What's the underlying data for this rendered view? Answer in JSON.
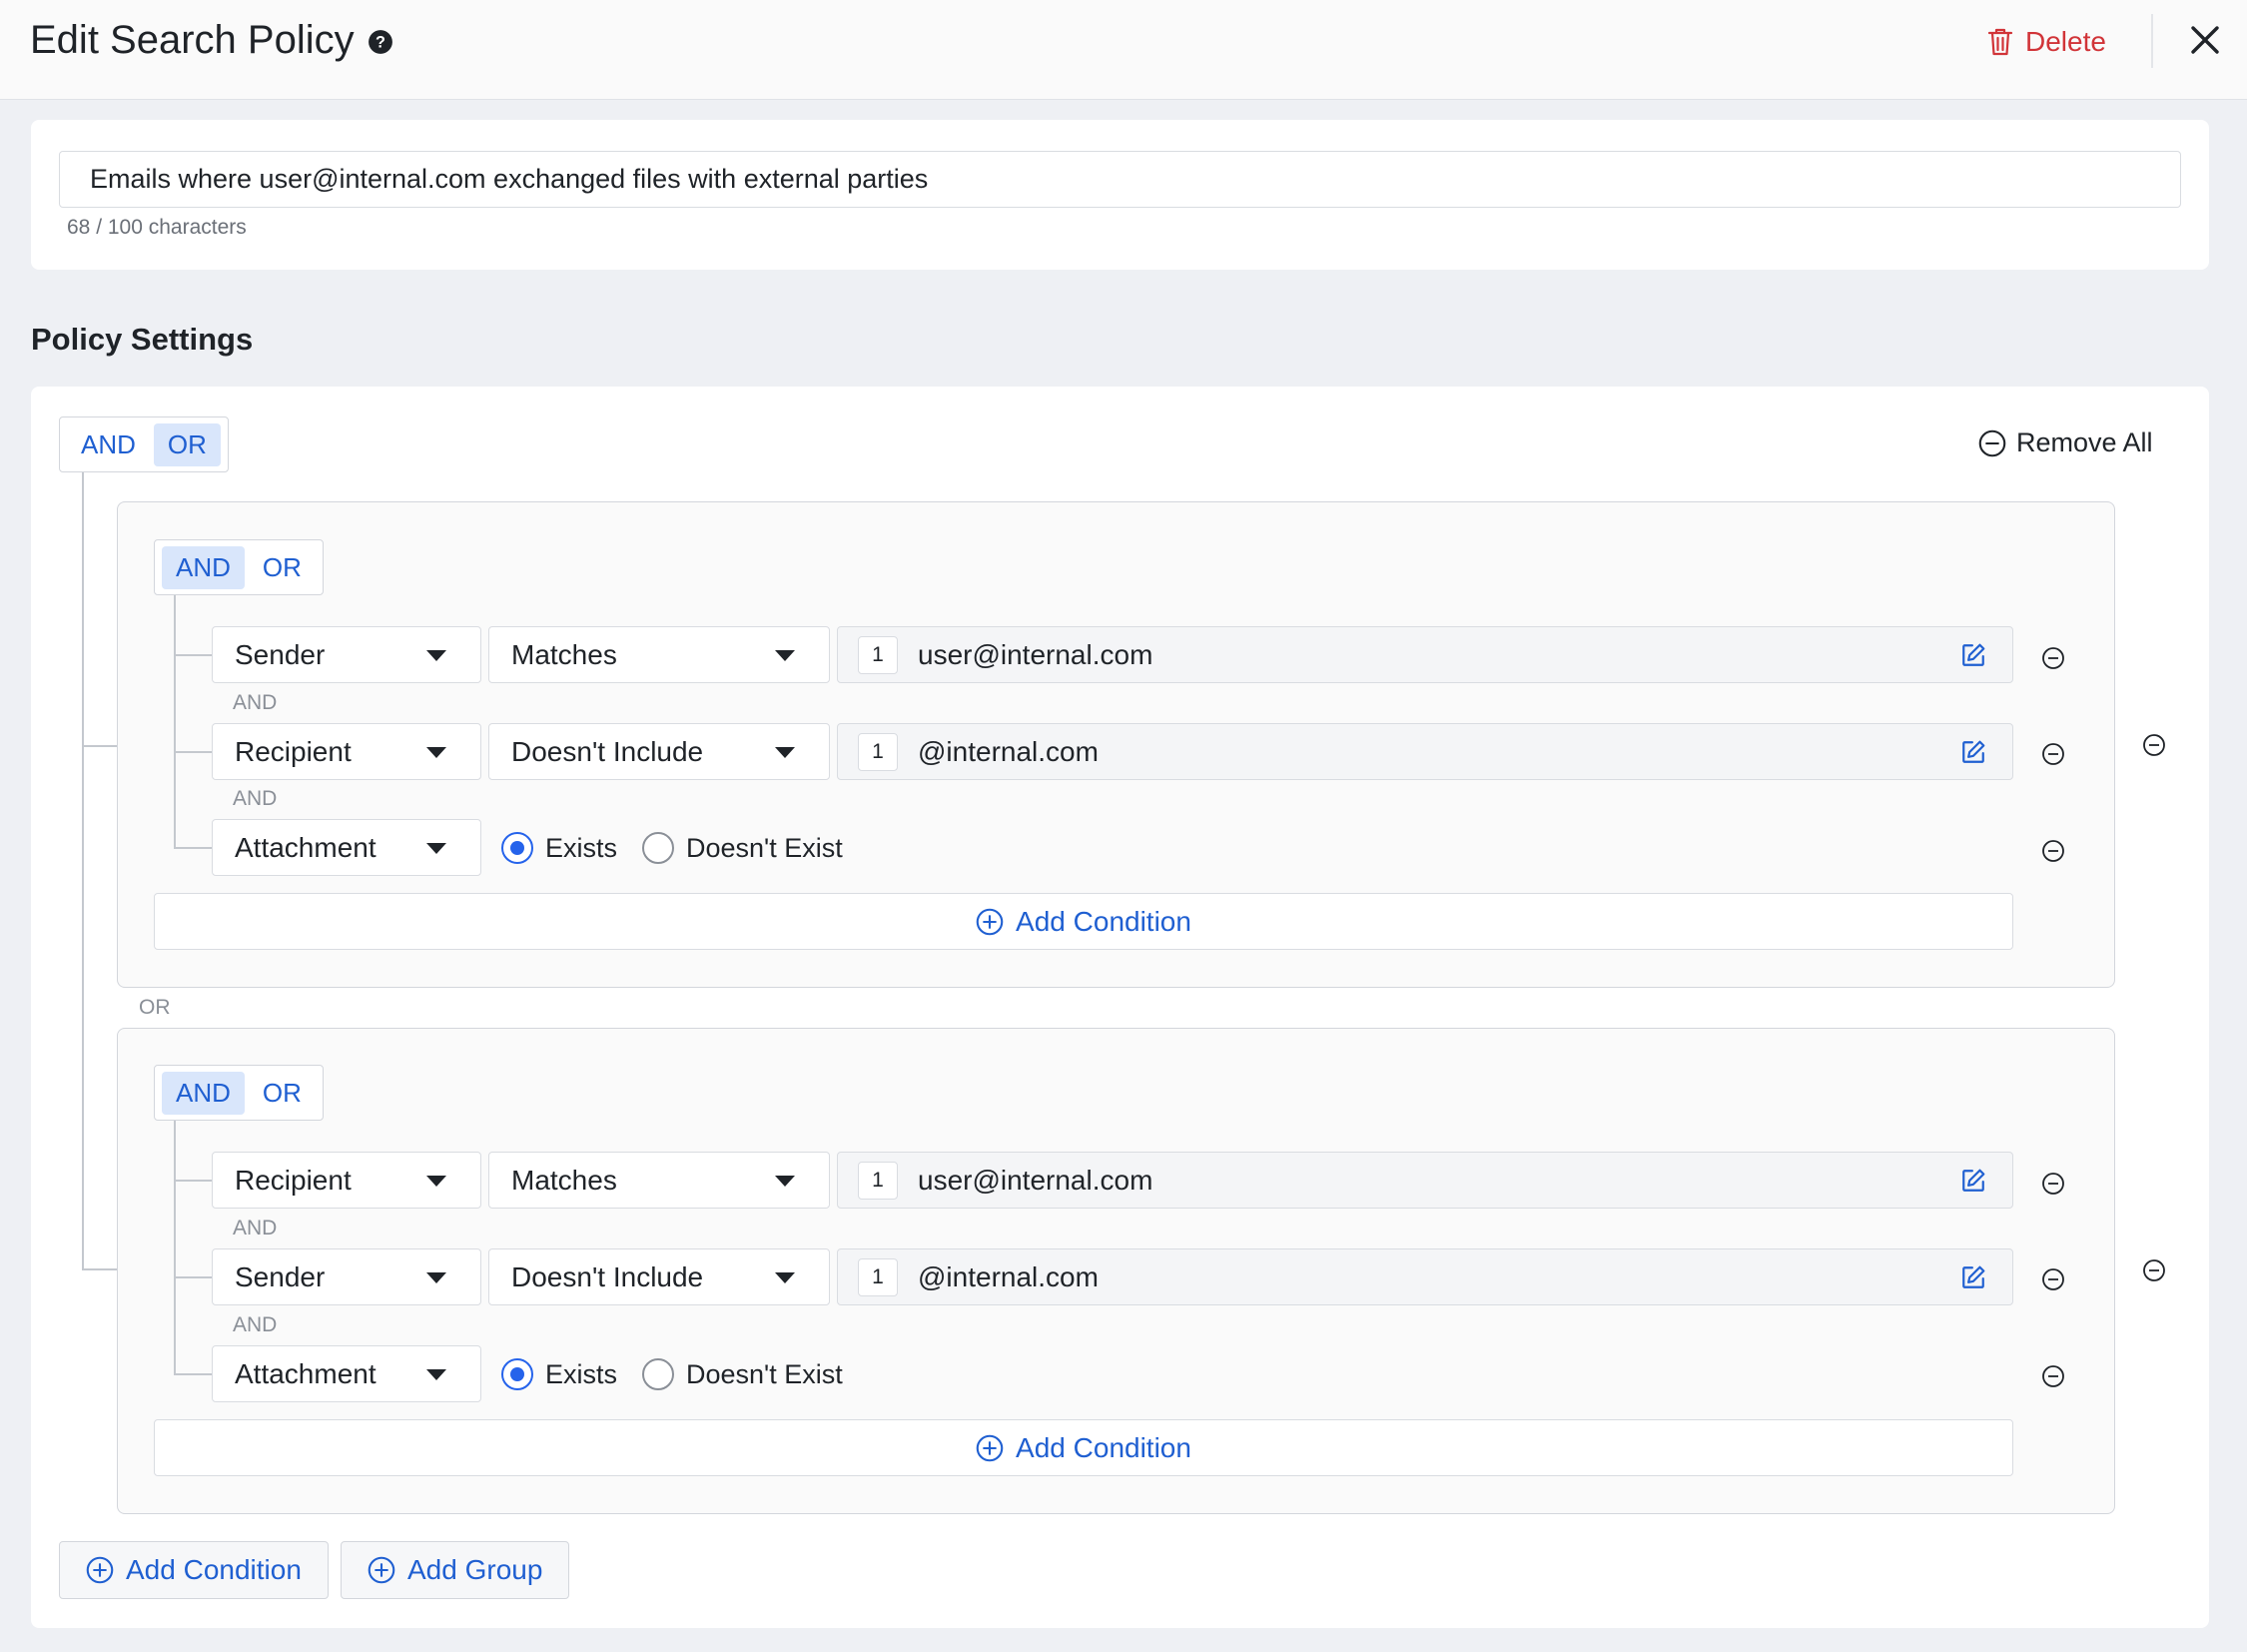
{
  "header": {
    "title": "Edit Search Policy",
    "delete_label": "Delete"
  },
  "policy_name": {
    "value": "Emails where user@internal.com exchanged files with external parties",
    "char_count": "68 / 100 characters"
  },
  "settings": {
    "title": "Policy Settings",
    "root_toggle": {
      "and": "AND",
      "or": "OR",
      "active": "OR"
    },
    "remove_all_label": "Remove All",
    "group_separator": "OR",
    "groups": [
      {
        "toggle": {
          "and": "AND",
          "or": "OR",
          "active": "AND"
        },
        "conditions": [
          {
            "field": "Sender",
            "operator": "Matches",
            "count": "1",
            "value": "user@internal.com"
          },
          {
            "field": "Recipient",
            "operator": "Doesn't Include",
            "count": "1",
            "value": "@internal.com"
          },
          {
            "field": "Attachment",
            "radio_exists": "Exists",
            "radio_not_exists": "Doesn't Exist",
            "selected": "Exists"
          }
        ],
        "connector": "AND",
        "add_condition_label": "Add Condition"
      },
      {
        "toggle": {
          "and": "AND",
          "or": "OR",
          "active": "AND"
        },
        "conditions": [
          {
            "field": "Recipient",
            "operator": "Matches",
            "count": "1",
            "value": "user@internal.com"
          },
          {
            "field": "Sender",
            "operator": "Doesn't Include",
            "count": "1",
            "value": "@internal.com"
          },
          {
            "field": "Attachment",
            "radio_exists": "Exists",
            "radio_not_exists": "Doesn't Exist",
            "selected": "Exists"
          }
        ],
        "connector": "AND",
        "add_condition_label": "Add Condition"
      }
    ]
  },
  "footer": {
    "add_condition_label": "Add Condition",
    "add_group_label": "Add Group"
  },
  "colors": {
    "accent": "#1f5fd1",
    "danger": "#d13438",
    "toggle_active_bg": "#d9e6fb"
  }
}
